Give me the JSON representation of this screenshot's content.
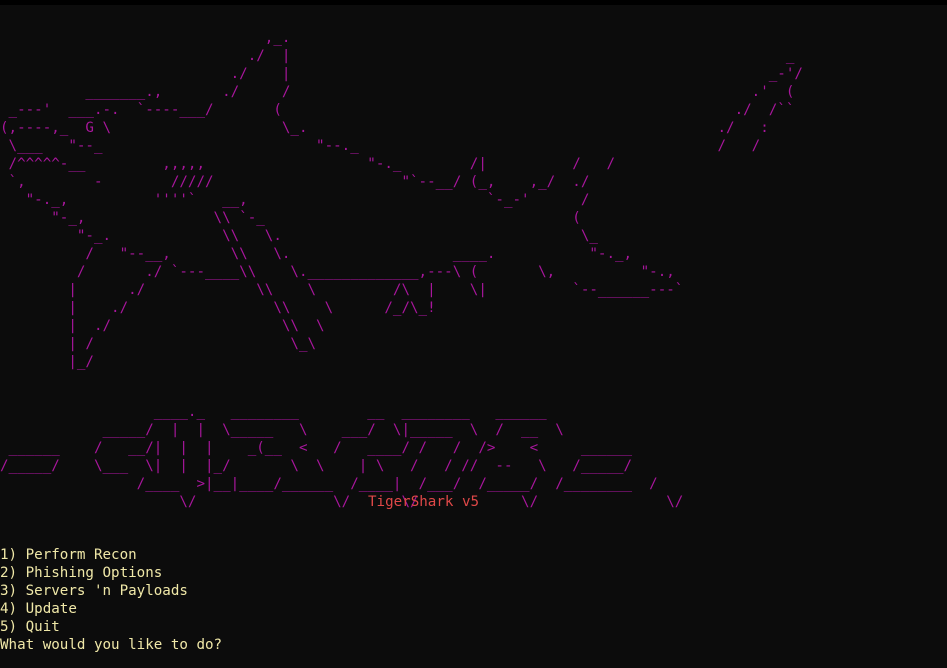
{
  "terminal": {
    "ascii_art_color": "#a8169c",
    "version_color": "#e04848",
    "menu_color": "#f0e8a8",
    "background": "#0c0c0c"
  },
  "shark_art": "                               ,_.\n                             ./  |                                                          _\n                           ./    |                                                        _-'/\n          _______.,       ./     /                                                      .'  (\n _---'  ___.-.  `----___/       (                                                     ./  /``\n(,----,_  G \\                    \\_.                                                ./   :\n \\___   \"--_                         \"--._                                          /   /\n /^^^^^-__         ,,,,,                   \"-._        /|          /   /\n `,        -        /////                      \"`--__/ (_,    ,_/  ./\n   \"-._,          ''''`   __,                            `-_-'      /\n      \"-_,               \\\\ `-_                                    (\n         \"-_.             \\\\   \\.                                   \\_\n          /   \"--__,       \\\\   \\.                   ____.           \"-._,\n         /       ./ `---____\\\\    \\._____________,---\\ (       \\,          \"-.,\n        |      ./             \\\\    \\         /\\  |    \\|          `--______---`\n        |    ./                 \\\\    \\      /_/\\_!\n        |  ./                    \\\\  \\\n        | /                       \\_\\\n        |_/",
  "logo_art": "                  ____._   ________        __  ________   ______\n            _____/  |  |  \\_____   \\    ___/  \\|_____  \\  /  __  \\\n ______    /   __/|  |  |    _(__  <   /   ____/ /   /  />    <     ______\n/_____/    \\___  \\|  |  |_/       \\  \\    | \\   /   / //  --   \\   /_____/\n                /____  >|__|____/______  /____|  /___/  /_____/  /________  /\n                     \\/                \\/      \\/            \\/               \\/",
  "version_label": "TigerShark v5",
  "menu": {
    "items": [
      {
        "label": "1) Perform Recon"
      },
      {
        "label": "2) Phishing Options"
      },
      {
        "label": "3) Servers 'n Payloads"
      },
      {
        "label": "4) Update"
      },
      {
        "label": "5) Quit"
      }
    ],
    "prompt": "What would you like to do?"
  }
}
